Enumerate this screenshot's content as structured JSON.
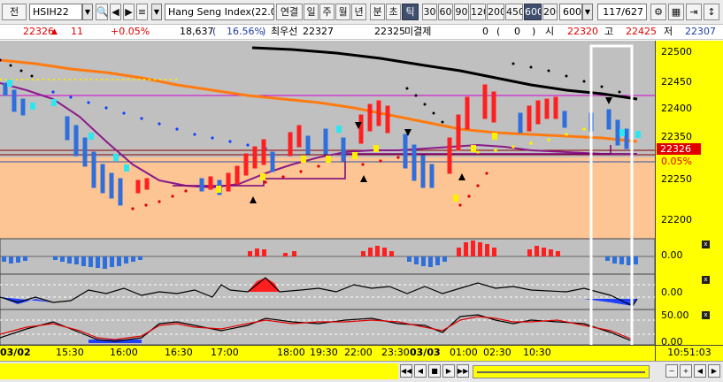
{
  "toolbar": {
    "left_tab": "전",
    "symbol": "HSIH22",
    "name": "Hang Seng Index(22.0",
    "items": [
      "연결",
      "일",
      "주",
      "월",
      "년",
      "분",
      "초",
      "틱"
    ],
    "selected_item": "틱",
    "intervals": [
      "30",
      "60",
      "90",
      "120",
      "200",
      "450",
      "600",
      "200"
    ],
    "selected_interval": "600",
    "tick_value": "600",
    "count": "117/627"
  },
  "status": {
    "price": "22326",
    "direction_icon": "up-triangle-icon",
    "change": "11",
    "change_pct": "+0.05%",
    "volume": "18,637",
    "volume_ratio": "16.56%",
    "best_bid_label": "최우선",
    "best_bid": "22327",
    "best_ask": "22325",
    "unfilled_label": "미결제",
    "unfilled": "0",
    "unfilled_change": "0",
    "open_label": "시",
    "open": "22320",
    "high_label": "고",
    "high": "22425",
    "low_label": "저",
    "low": "22307"
  },
  "price_axis": [
    "22500",
    "22450",
    "22400",
    "22350",
    "22300",
    "22250",
    "22200"
  ],
  "current_price_tag": "22326",
  "current_pct_tag": "0.05%",
  "indicator_labels": [
    "0.00",
    "0.00",
    "50.00",
    "0.00"
  ],
  "time_axis": [
    "03/02",
    "15:30",
    "16:00",
    "16:30",
    "17:00",
    "18:00",
    "19:30",
    "22:00",
    "23:30",
    "03/03",
    "01:00",
    "02:30",
    "10:30"
  ],
  "clock": "10:51:03",
  "colors": {
    "price_bg": "#c0c0c0",
    "peach_bg": "#fdc594",
    "axis_bg": "#ffff00",
    "up_candle": "#ff1f1f",
    "down_candle": "#2f6fdc",
    "ma_long": "#000000",
    "ma_mid": "#ff7a10",
    "ma_short": "#8a1a8a"
  }
}
